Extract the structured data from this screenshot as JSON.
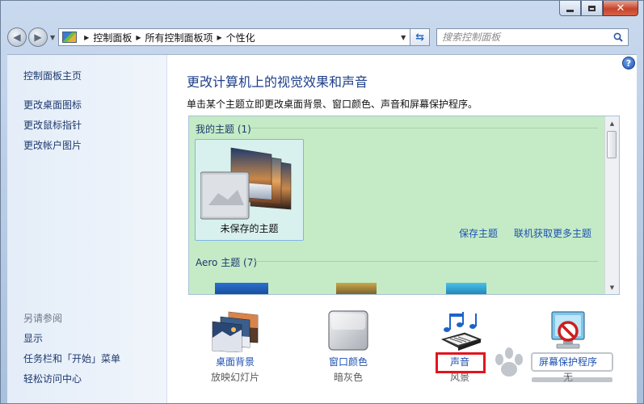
{
  "window": {
    "close_glyph": "✕",
    "colors": {
      "frame": "#c9d9ee",
      "close": "#c7432b"
    }
  },
  "navbar": {
    "breadcrumbs": [
      "控制面板",
      "所有控制面板项",
      "个性化"
    ],
    "search_placeholder": "搜索控制面板"
  },
  "sidebar": {
    "home": "控制面板主页",
    "links": [
      "更改桌面图标",
      "更改鼠标指针",
      "更改帐户图片"
    ],
    "see_also_heading": "另请参阅",
    "see_also": [
      "显示",
      "任务栏和「开始」菜单",
      "轻松访问中心"
    ]
  },
  "main": {
    "title": "更改计算机上的视觉效果和声音",
    "description": "单击某个主题立即更改桌面背景、窗口颜色、声音和屏幕保护程序。",
    "my_themes_label": "我的主题 (1)",
    "unsaved_theme": "未保存的主题",
    "save_theme": "保存主题",
    "get_more_online": "联机获取更多主题",
    "aero_label": "Aero 主题 (7)",
    "panel_color": "#c4ebc5"
  },
  "bottom": [
    {
      "label": "桌面背景",
      "value": "放映幻灯片",
      "icon": "desktop-background-icon"
    },
    {
      "label": "窗口颜色",
      "value": "暗灰色",
      "icon": "window-color-icon"
    },
    {
      "label": "声音",
      "value": "风景",
      "icon": "sound-icon"
    },
    {
      "label": "屏幕保护程序",
      "value": "无",
      "icon": "screensaver-icon"
    }
  ],
  "highlight_color": "#e0161d"
}
